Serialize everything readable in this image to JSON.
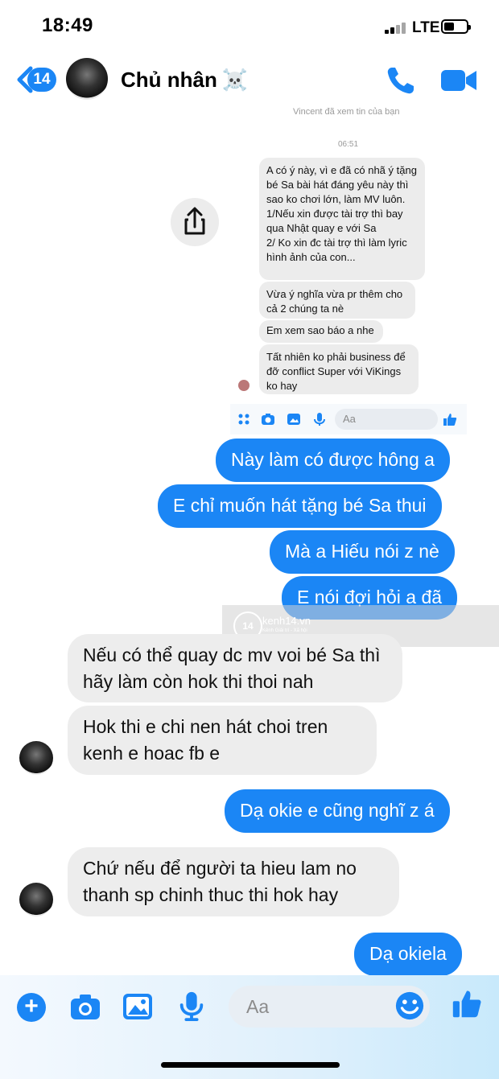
{
  "status_bar": {
    "time": "18:49",
    "network": "LTE"
  },
  "header": {
    "unread_count": "14",
    "contact_name": "Chủ nhân",
    "name_emoji": "☠️"
  },
  "inner_screenshot": {
    "seen_text": "Vincent đã xem tin của bạn",
    "timestamp": "06:51",
    "messages": [
      "A có ý này, vì e đã có nhã ý tặng bé Sa bài hát đáng yêu này thì sao ko chơi lớn, làm MV luôn.\n1/Nếu xin được tài trợ thì bay qua Nhật quay e với Sa\n2/ Ko xin đc tài trợ thì làm lyric hình ảnh của con...",
      "Vừa ý nghĩa vừa pr thêm cho cả 2 chúng ta nè",
      "Em xem sao báo a nhe",
      "Tất nhiên ko phải business để đỡ conflict Super với ViKings ko hay"
    ],
    "input_placeholder": "Aa"
  },
  "messages": [
    {
      "side": "out",
      "text": "Này làm có được hông a"
    },
    {
      "side": "out",
      "text": "E chỉ muốn hát tặng bé Sa thui"
    },
    {
      "side": "out",
      "text": "Mà a Hiếu nói z nè"
    },
    {
      "side": "out",
      "text": "E nói đợi hỏi a đã"
    },
    {
      "side": "in",
      "text": "Nếu có thể quay dc mv voi bé Sa thì hãy làm còn hok thi thoi nah"
    },
    {
      "side": "in",
      "text": "Hok thi e chi nen hát choi tren kenh e hoac fb e"
    },
    {
      "side": "out",
      "text": "Dạ okie e cũng nghĩ z á"
    },
    {
      "side": "in",
      "text": "Chứ nếu để người ta hieu lam no thanh sp chinh thuc thi hok hay"
    },
    {
      "side": "out",
      "text": "Dạ okiela"
    }
  ],
  "watermark": {
    "logo": "14",
    "site": "kenh14.vn",
    "tagline": "Kênh Giải trí - Xã hội"
  },
  "composer": {
    "placeholder": "Aa"
  },
  "colors": {
    "accent": "#1b86f5",
    "incoming": "#ededed"
  }
}
